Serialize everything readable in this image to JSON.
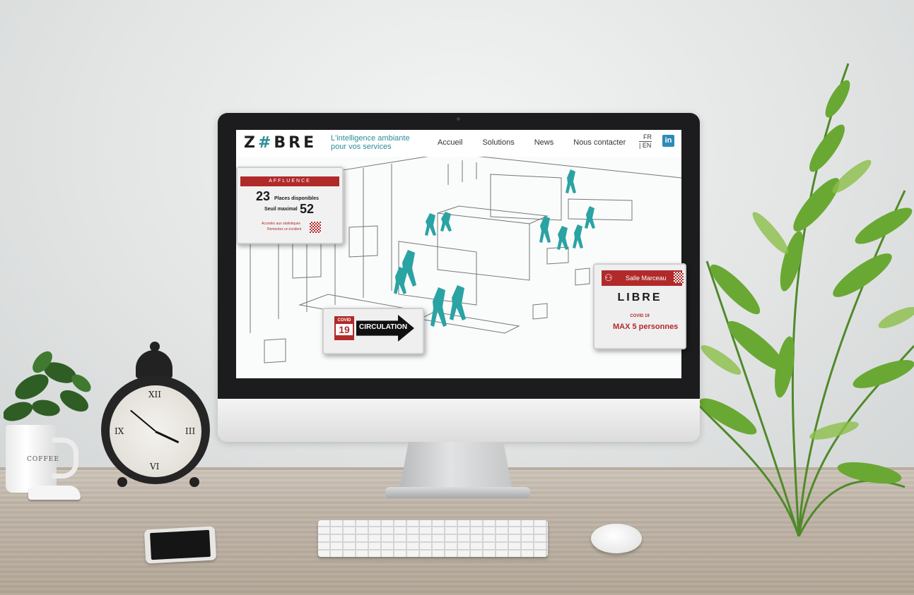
{
  "site": {
    "logo_pre": "Z",
    "logo_hash": "#",
    "logo_post": "BRE",
    "tagline_line1": "L'intelligence ambiante",
    "tagline_line2": "pour vos services",
    "nav": [
      {
        "label": "Accueil"
      },
      {
        "label": "Solutions"
      },
      {
        "label": "News"
      },
      {
        "label": "Nous contacter"
      }
    ],
    "lang_fr": "FR",
    "lang_en": "| EN",
    "linkedin_label": "in",
    "accent_color": "#2d8c98",
    "brand_red": "#b12a2a"
  },
  "affluence": {
    "title": "AFFLUENCE",
    "count": "23",
    "count_label": "Places disponibles",
    "threshold_label": "Seuil maximal",
    "threshold": "52",
    "link_stats": "Accedez aux statistiques",
    "link_incident": "Remontez un incident"
  },
  "circulation": {
    "covid_label": "COVID",
    "covid_number": "19",
    "arrow_label": "CIRCULATION"
  },
  "salle": {
    "room_name": "Salle Marceau",
    "status": "LIBRE",
    "covid_label": "COVID 19",
    "max_label": "MAX 5 personnes"
  },
  "desk": {
    "mug_text": "COFFEE",
    "clock_numerals": [
      "XII",
      "III",
      "VI",
      "IX"
    ]
  }
}
